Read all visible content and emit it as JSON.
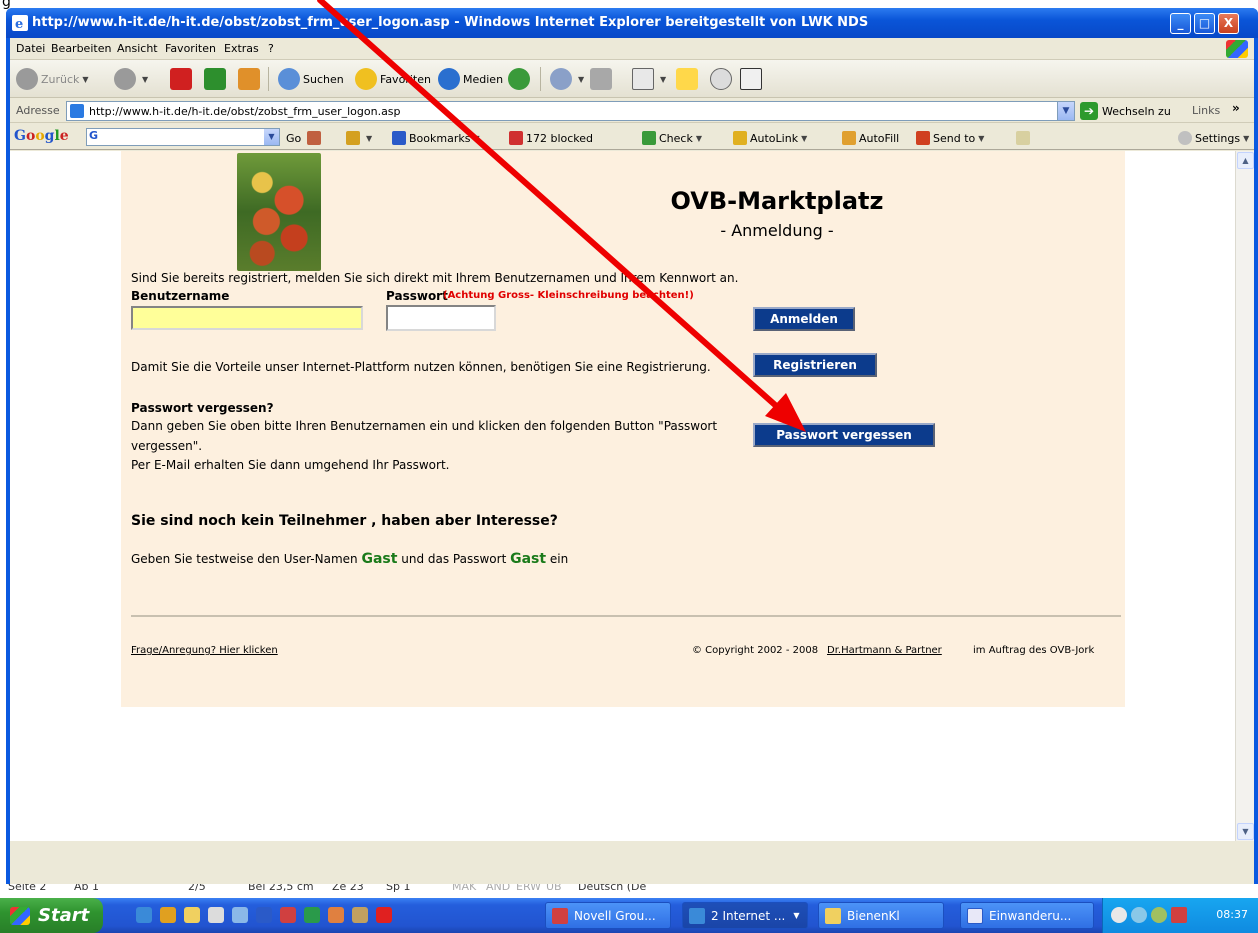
{
  "background_doc": {
    "top_text": "g",
    "status_fields": [
      "Seite 2",
      "Ab 1",
      "2/5",
      "Bei 23,5 cm",
      "Ze 23",
      "Sp 1",
      "MAK",
      "ÄND",
      "ERW",
      "ÜB",
      "Deutsch (De"
    ]
  },
  "window": {
    "title": "http://www.h-it.de/h-it.de/obst/zobst_frm_user_logon.asp - Windows Internet Explorer bereitgestellt von LWK NDS",
    "min_label": "_",
    "max_label": "□",
    "close_label": "X"
  },
  "menu": {
    "items": [
      "Datei",
      "Bearbeiten",
      "Ansicht",
      "Favoriten",
      "Extras",
      "?"
    ]
  },
  "toolbar": {
    "back": "Zurück",
    "search": "Suchen",
    "favorites": "Favoriten",
    "media": "Medien"
  },
  "address": {
    "label": "Adresse",
    "url": "http://www.h-it.de/h-it.de/obst/zobst_frm_user_logon.asp",
    "go": "Wechseln zu",
    "links": "Links",
    "more": "»"
  },
  "google_bar": {
    "logo": [
      "G",
      "o",
      "o",
      "g",
      "l",
      "e"
    ],
    "search_btn": "G",
    "go": "Go",
    "bookmarks": "Bookmarks",
    "blocked": "172 blocked",
    "check": "Check",
    "autolink": "AutoLink",
    "autofill": "AutoFill",
    "send_to": "Send to",
    "settings": "Settings"
  },
  "page": {
    "title": "OVB-Marktplatz",
    "subtitle": "- Anmeldung -",
    "intro": "Sind Sie bereits registriert, melden Sie sich direkt mit Ihrem Benutzernamen und Ihrem Kennwort an.",
    "user_label": "Benutzername",
    "pass_label": "Passwort",
    "pass_hint": "(Achtung Gross- Kleinschreibung beachten!)",
    "login_button": "Anmelden",
    "register_text": "Damit Sie die Vorteile unser Internet-Plattform nutzen können, benötigen Sie eine Registrierung.",
    "register_button": "Registrieren",
    "forgot_heading": "Passwort vergessen?",
    "forgot_line1": "Dann geben Sie oben bitte Ihren Benutzernamen ein und klicken den folgenden Button \"Passwort",
    "forgot_line2": "vergessen\".",
    "forgot_line3": "Per E-Mail erhalten Sie dann umgehend Ihr Passwort.",
    "forgot_button": "Passwort vergessen",
    "guest_heading": "Sie sind noch kein Teilnehmer , haben aber Interesse?",
    "guest_pre": "Geben Sie testweise den User-Namen",
    "guest_name": "Gast",
    "guest_mid": "und das Passwort",
    "guest_pass": "Gast",
    "guest_post": "ein",
    "footer_feedback": "Frage/Anregung? Hier klicken",
    "footer_copyright": "© Copyright 2002 - 2008",
    "footer_partner": "Dr.Hartmann & Partner",
    "footer_client": "im Auftrag des OVB-Jork"
  },
  "taskbar": {
    "start": "Start",
    "tasks": [
      "Novell Grou...",
      "2 Internet ...",
      "BienenKl",
      "Einwanderu..."
    ],
    "clock": "08:37"
  },
  "colors": {
    "page_bg": "#fdf0df",
    "button_blue": "#0c3b8c",
    "hint_red": "#e00000",
    "gast_green": "#1a7a1a",
    "arrow_red": "#ee0000"
  },
  "icons": {
    "ie": "ie-icon",
    "back": "back-arrow-icon",
    "forward": "forward-arrow-icon",
    "stop": "stop-icon",
    "refresh": "refresh-icon",
    "home": "home-icon"
  }
}
